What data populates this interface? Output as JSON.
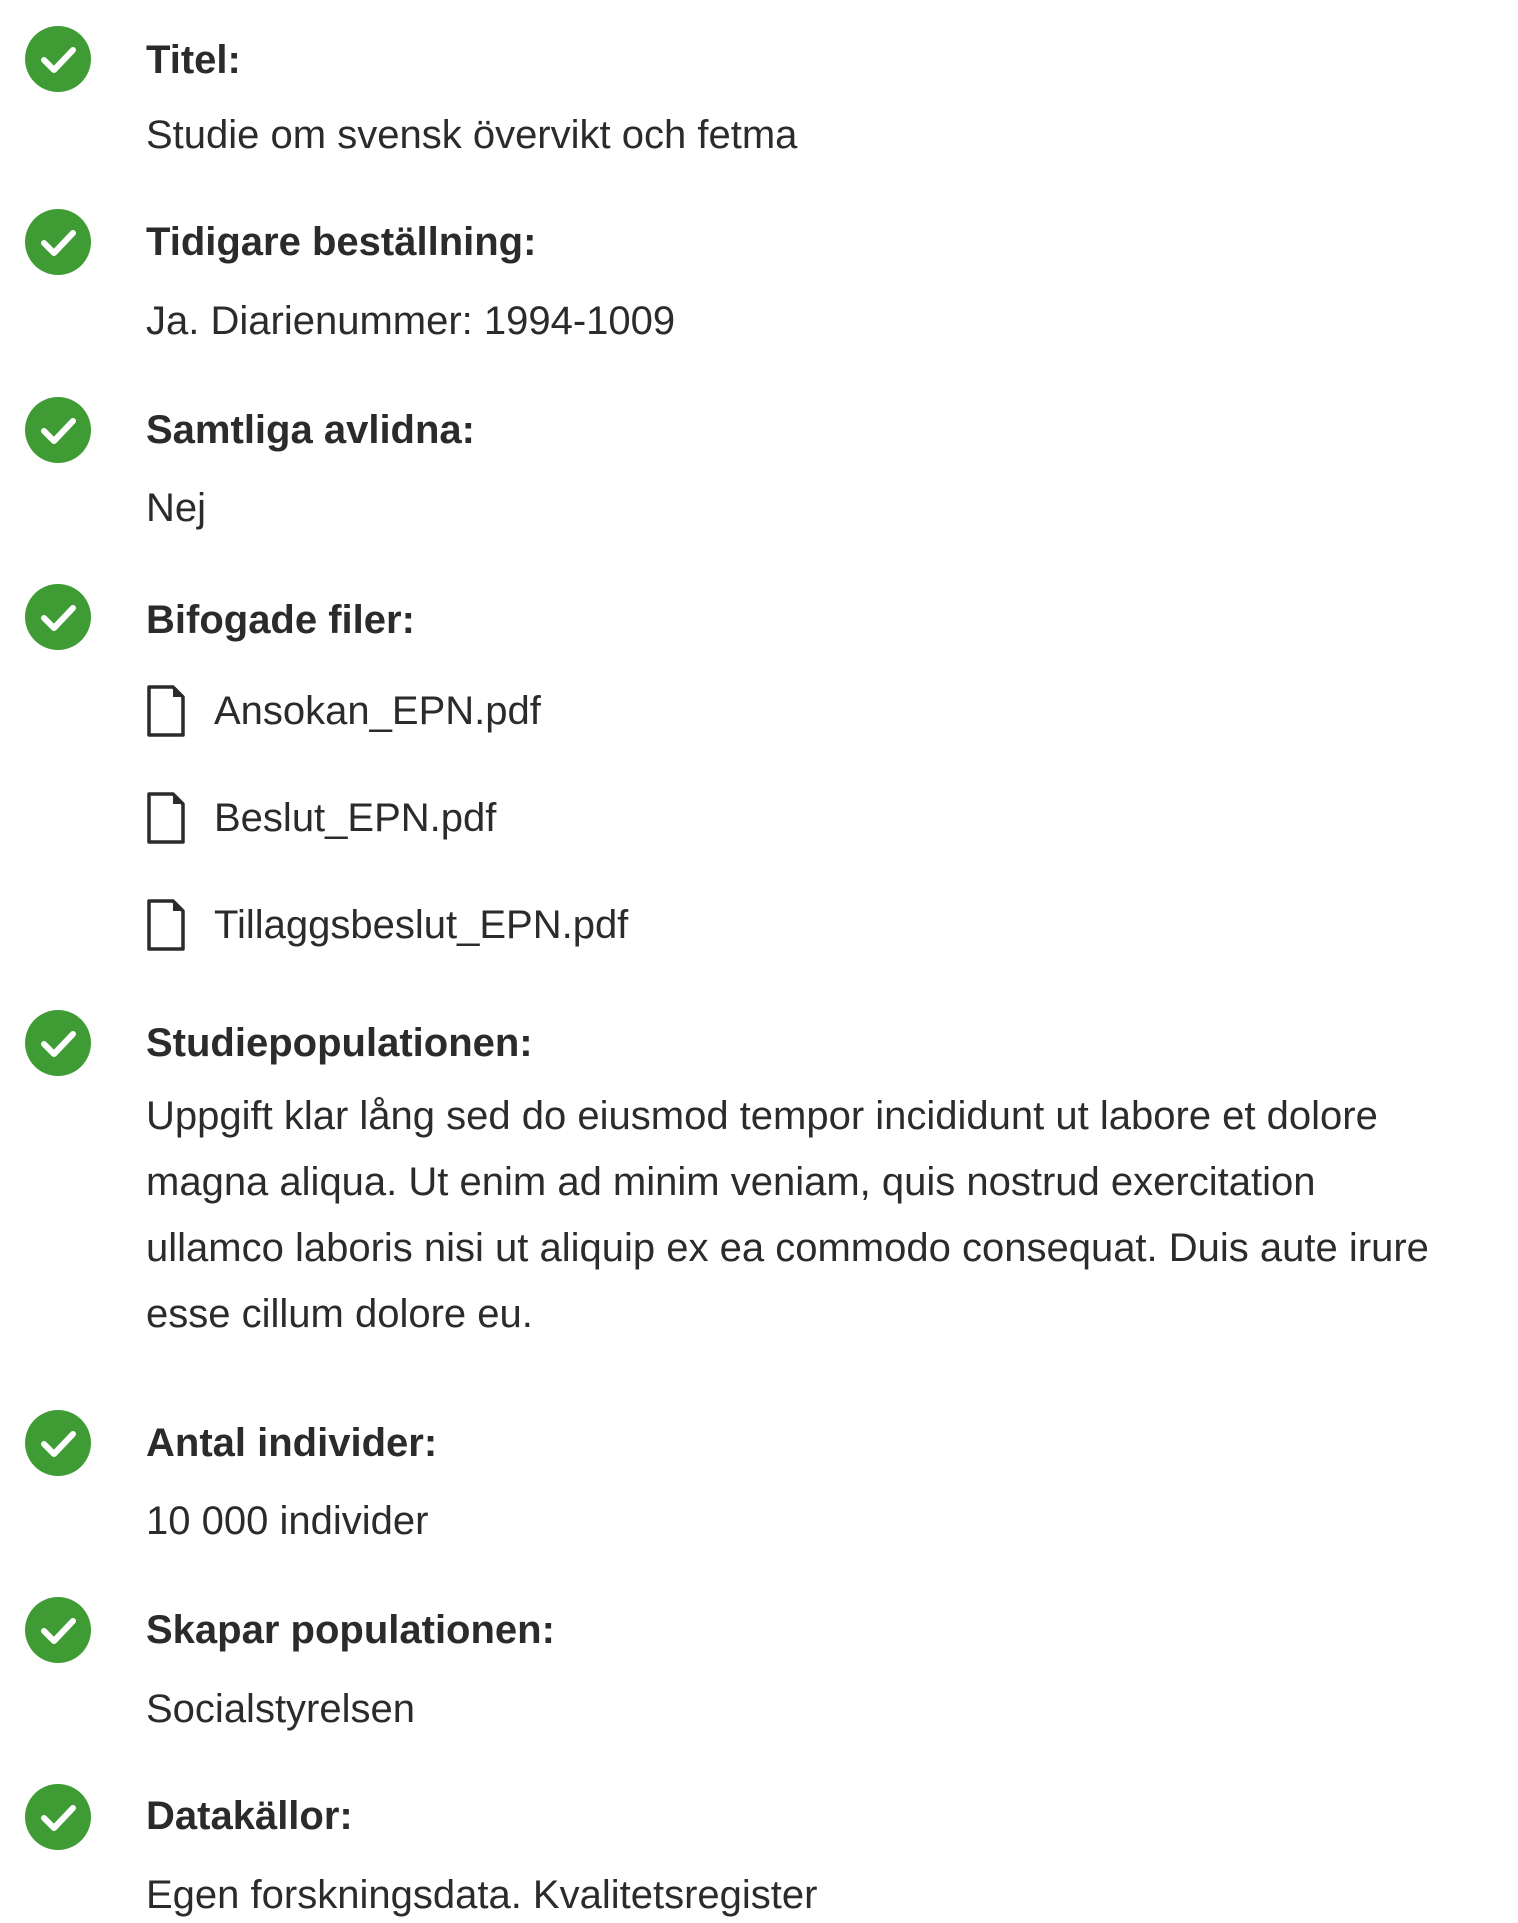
{
  "colors": {
    "check_green": "#3f9c35",
    "text": "#2b2b2b"
  },
  "sections": {
    "titel": {
      "label": "Titel:",
      "value": "Studie om svensk övervikt och fetma",
      "icon": "check-circle-icon"
    },
    "tidigare": {
      "label": "Tidigare beställning:",
      "value": "Ja. Diarienummer: 1994-1009",
      "icon": "check-circle-icon"
    },
    "avlidna": {
      "label": "Samtliga avlidna:",
      "value": "Nej",
      "icon": "check-circle-icon"
    },
    "filer": {
      "label": "Bifogade filer:",
      "icon": "check-circle-icon",
      "files": [
        {
          "name": "Ansokan_EPN.pdf",
          "icon": "file-icon"
        },
        {
          "name": "Beslut_EPN.pdf",
          "icon": "file-icon"
        },
        {
          "name": "Tillaggsbeslut_EPN.pdf",
          "icon": "file-icon"
        }
      ]
    },
    "studiepopulationen": {
      "label": "Studiepopulationen:",
      "icon": "check-circle-icon",
      "lines": [
        "Uppgift klar lång sed do eiusmod tempor incididunt ut labore et dolore",
        "magna aliqua. Ut enim ad minim veniam, quis nostrud exercitation",
        "ullamco laboris nisi ut aliquip ex ea commodo consequat. Duis aute irure",
        "esse cillum dolore eu."
      ]
    },
    "antal": {
      "label": "Antal individer:",
      "value": "10 000 individer",
      "icon": "check-circle-icon"
    },
    "skapar": {
      "label": "Skapar populationen:",
      "value": "Socialstyrelsen",
      "icon": "check-circle-icon"
    },
    "datakallor": {
      "label": "Datakällor:",
      "value": "Egen forskningsdata. Kvalitetsregister",
      "icon": "check-circle-icon"
    }
  }
}
